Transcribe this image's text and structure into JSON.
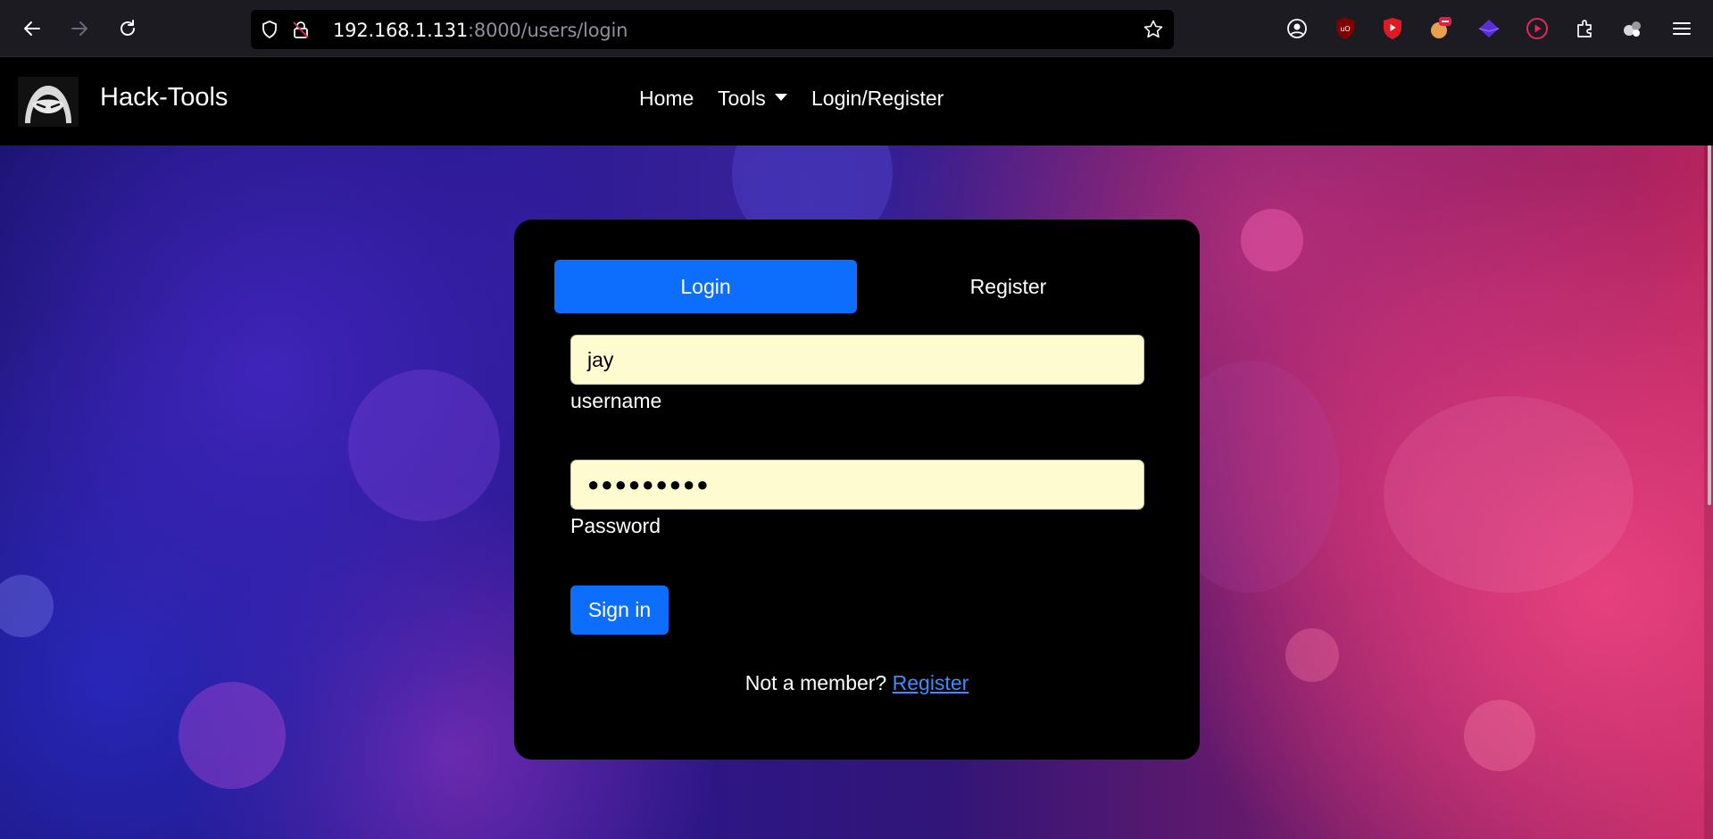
{
  "browser": {
    "url_host": "192.168.1.131",
    "url_rest": ":8000/users/login"
  },
  "navbar": {
    "brand": "Hack-Tools",
    "links": [
      "Home",
      "Tools",
      "Login/Register"
    ]
  },
  "auth": {
    "tabs": [
      "Login",
      "Register"
    ],
    "active_tab": "Login",
    "username_value": "jay",
    "username_label": "username",
    "password_value": "●●●●●●●●●",
    "password_label": "Password",
    "signin_label": "Sign in",
    "member_prompt": "Not a member?",
    "register_link": "Register"
  },
  "colors": {
    "primary": "#0d6efd",
    "input_bg": "#fefbd0",
    "link": "#3d8bfd"
  }
}
